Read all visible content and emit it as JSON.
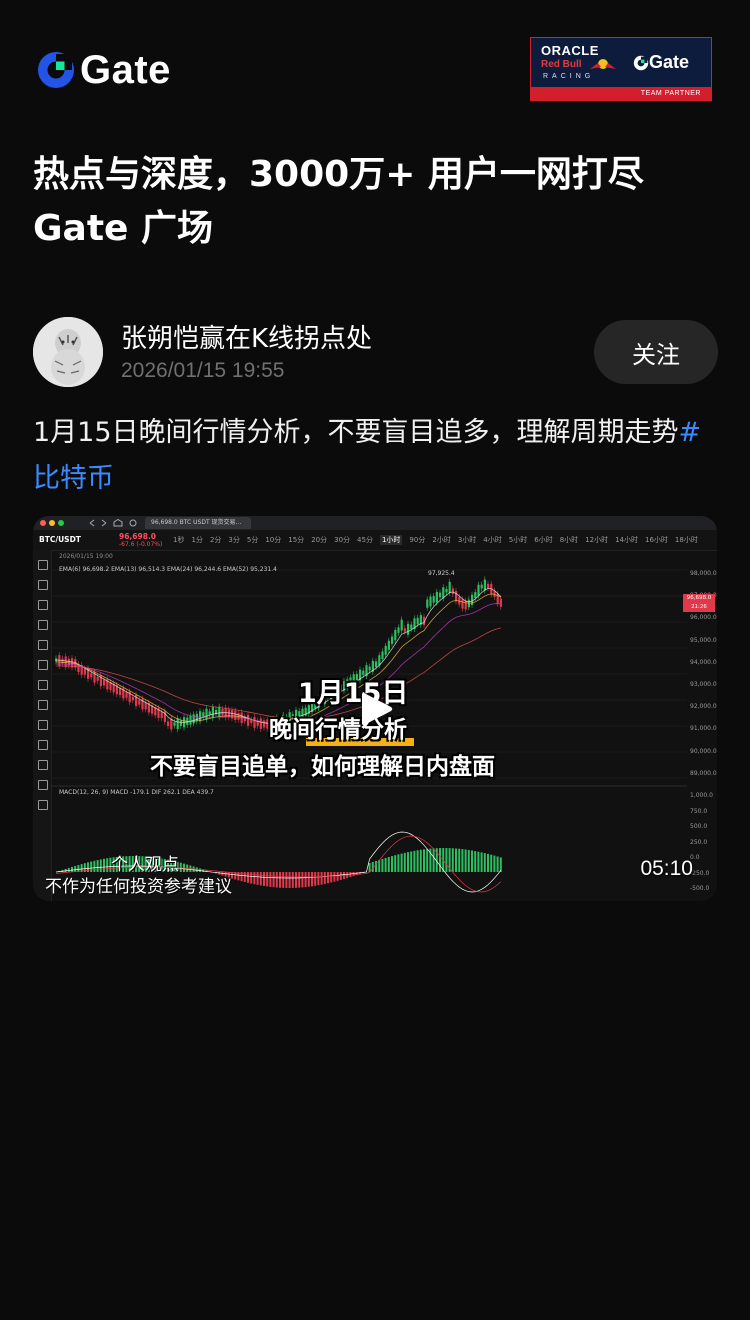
{
  "brand": {
    "name": "Gate",
    "accent": "#17e6a1",
    "blue": "#2354e6"
  },
  "partner": {
    "oracle": "ORACLE",
    "redbull": "Red Bull",
    "racing": "RACING",
    "gate": "Gate",
    "tag": "TEAM PARTNER"
  },
  "headline": {
    "line1": "热点与深度，3000万+ 用户一网打尽",
    "line2": "Gate 广场"
  },
  "post": {
    "author": "张朔恺赢在K线拐点处",
    "date": "2026/01/15 19:55",
    "follow_label": "关注",
    "text": "1月15日晚间行情分析，不要盲目追多，理解周期走势",
    "hashtag": "#比特币"
  },
  "video": {
    "tab_title": "96,698.0 BTC USDT 现货交易...",
    "pair": "BTC/USDT",
    "price": "96,698.0",
    "price_change": "-67.6 (-0.07%)",
    "timeframes": [
      "1秒",
      "1分",
      "2分",
      "3分",
      "5分",
      "10分",
      "15分",
      "20分",
      "30分",
      "45分",
      "1小时",
      "90分",
      "2小时",
      "3小时",
      "4小时",
      "5小时",
      "6小时",
      "8小时",
      "12小时",
      "14小时",
      "16小时",
      "18小时"
    ],
    "selected_timeframe": "1小时",
    "date_label": "2026/01/15 19:00",
    "ema_line": "EMA(6) 96,698.2   EMA(13) 96,514.3   EMA(24) 96,244.6   EMA(52) 95,231.4",
    "macd_line": "MACD(12, 26, 9)   MACD -179.1   DIF 262.1   DEA 439.7",
    "peak_label": "97,925.4",
    "y_ticks": [
      "98,000.0",
      "97,000.0",
      "96,000.0",
      "95,000.0",
      "94,000.0",
      "93,000.0",
      "92,000.0",
      "91,000.0",
      "90,000.0",
      "89,000.0"
    ],
    "price_tag": "96,698.0",
    "price_tag_time": "21:26",
    "macd_ticks": [
      "1,000.0",
      "750.0",
      "500.0",
      "250.0",
      "0.0",
      "-250.0",
      "-500.0"
    ],
    "overlay_line1": "1月15日",
    "overlay_line2": "晚间行情分析",
    "overlay_line3": "不要盲目追单，如何理解日内盘面",
    "note1": "个人观点",
    "note2": "不作为任何投资参考建议",
    "duration": "05:10"
  }
}
